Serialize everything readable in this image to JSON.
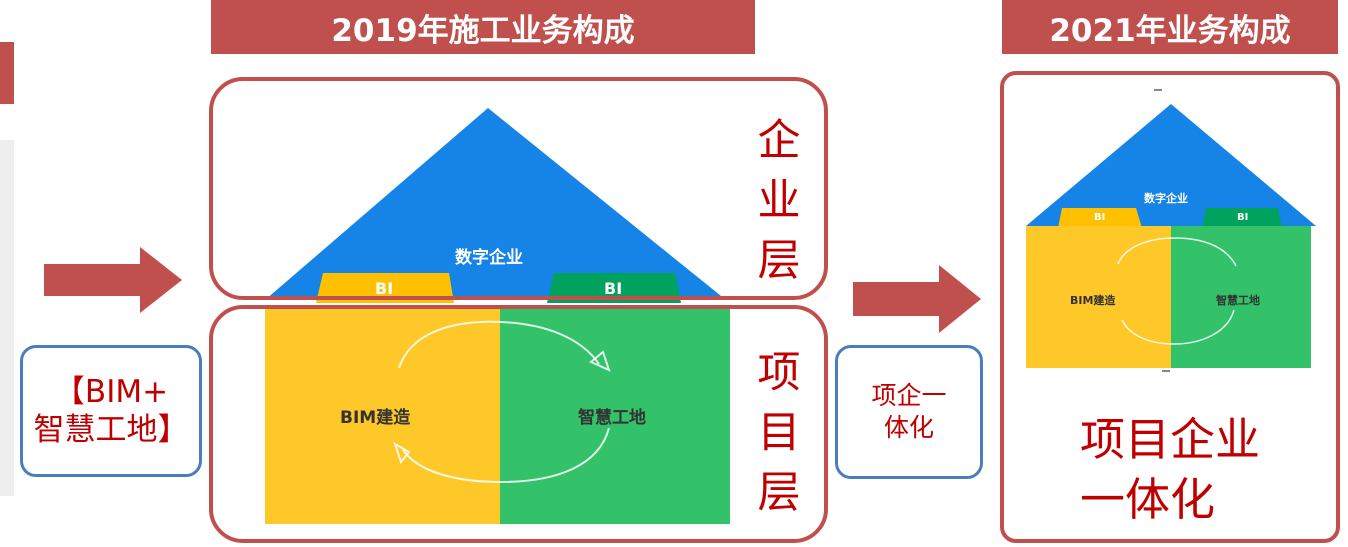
{
  "left_panel": {
    "intro_box": "【BIM+\n智慧工地】"
  },
  "diagram_2019": {
    "title": "2019年施工业务构成",
    "roof_label": "数字企业",
    "bi_left": "BI",
    "bi_right": "BI",
    "block_left": "BIM建造",
    "block_right": "智慧工地",
    "enterprise_layer": [
      "企",
      "业",
      "层"
    ],
    "project_layer": [
      "项",
      "目",
      "层"
    ]
  },
  "middle_box": "项企一\n体化",
  "diagram_2021": {
    "title": "2021年业务构成",
    "roof_label": "数字企业",
    "bi_left": "BI",
    "bi_right": "BI",
    "block_left": "BIM建造",
    "block_right": "智慧工地",
    "caption": "项目企业\n一体化"
  },
  "colors": {
    "banner": "#c0504d",
    "box_border": "#c0504d",
    "blue_box_border": "#4a7ebb",
    "roof_blue": "#1584e6",
    "bi_yellow": "#ffc000",
    "bi_green": "#00a25e",
    "block_yellow": "#ffc829",
    "block_green": "#33c16a",
    "text_red": "#c00000"
  }
}
